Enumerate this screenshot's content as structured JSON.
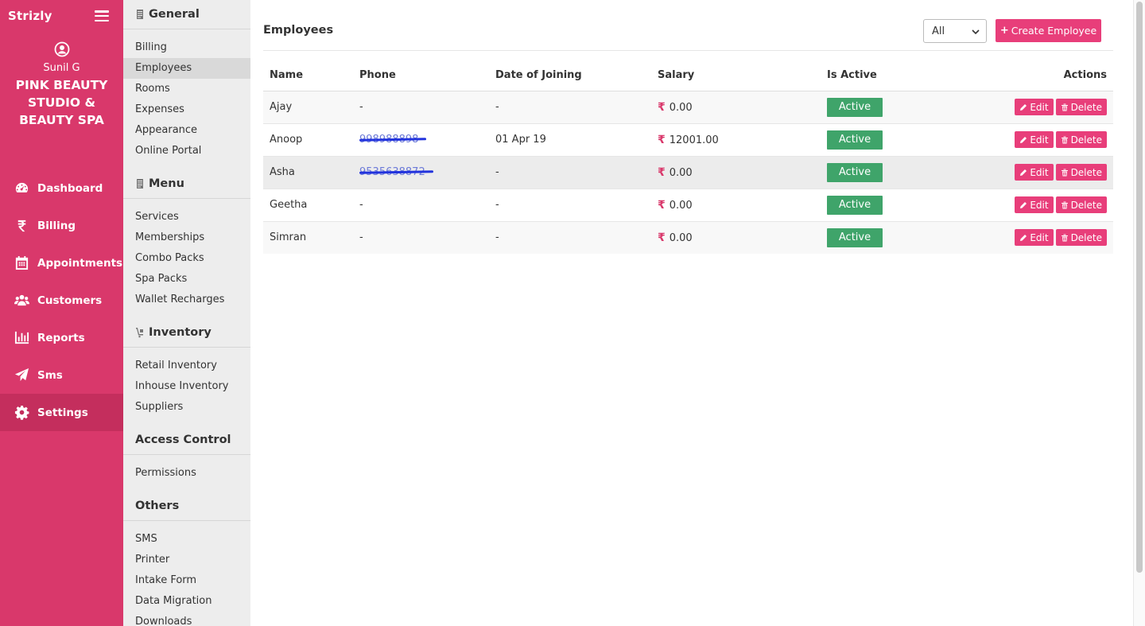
{
  "brand": "Strizly",
  "profile": {
    "username": "Sunil G",
    "org_name": "PINK BEAUTY STUDIO & BEAUTY SPA"
  },
  "nav": [
    {
      "label": "Dashboard",
      "icon": "dashboard-icon"
    },
    {
      "label": "Billing",
      "icon": "rupee-icon"
    },
    {
      "label": "Appointments",
      "icon": "calendar-icon"
    },
    {
      "label": "Customers",
      "icon": "users-icon"
    },
    {
      "label": "Reports",
      "icon": "bar-chart-icon"
    },
    {
      "label": "Sms",
      "icon": "paper-plane-icon"
    },
    {
      "label": "Settings",
      "icon": "gear-icon",
      "active": true
    }
  ],
  "settings_menu": {
    "general": {
      "title": "General",
      "items": [
        "Billing",
        "Employees",
        "Rooms",
        "Expenses",
        "Appearance",
        "Online Portal"
      ]
    },
    "menu": {
      "title": "Menu",
      "items": [
        "Services",
        "Memberships",
        "Combo Packs",
        "Spa Packs",
        "Wallet Recharges"
      ]
    },
    "inventory": {
      "title": "Inventory",
      "items": [
        "Retail Inventory",
        "Inhouse Inventory",
        "Suppliers"
      ]
    },
    "access": {
      "title": "Access Control",
      "items": [
        "Permissions"
      ]
    },
    "others": {
      "title": "Others",
      "items": [
        "SMS",
        "Printer",
        "Intake Form",
        "Data Migration",
        "Downloads"
      ]
    }
  },
  "page": {
    "title": "Employees",
    "filter_value": "All",
    "create_label": "Create Employee"
  },
  "table": {
    "columns": [
      "Name",
      "Phone",
      "Date of Joining",
      "Salary",
      "Is Active",
      "Actions"
    ],
    "edit_label": "Edit",
    "delete_label": "Delete",
    "rows": [
      {
        "name": "Ajay",
        "phone": "-",
        "doj": "-",
        "salary": "0.00",
        "status": "Active"
      },
      {
        "name": "Anoop",
        "phone": "998988898",
        "doj": "01 Apr 19",
        "salary": "12001.00",
        "status": "Active"
      },
      {
        "name": "Asha",
        "phone": "9535638872",
        "doj": "-",
        "salary": "0.00",
        "status": "Active"
      },
      {
        "name": "Geetha",
        "phone": "-",
        "doj": "-",
        "salary": "0.00",
        "status": "Active"
      },
      {
        "name": "Simran",
        "phone": "-",
        "doj": "-",
        "salary": "0.00",
        "status": "Active"
      }
    ]
  },
  "colors": {
    "sidebar": "#d9386b",
    "accent": "#e83e7a",
    "active_badge": "#3fa46a"
  }
}
